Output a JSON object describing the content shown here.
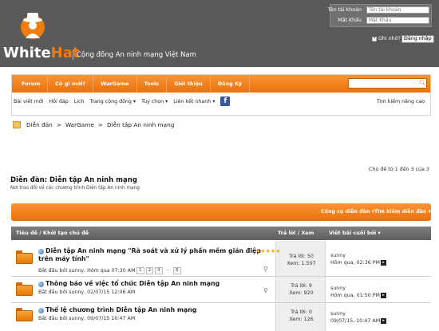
{
  "header": {
    "logo_white": "White",
    "logo_hat": "Hat",
    "tagline": "Cộng đồng An ninh mạng Việt Nam"
  },
  "login": {
    "username_label": "Tên tài khoản",
    "username_placeholder": "Tên tài khoản",
    "password_label": "Mật Khẩu",
    "password_placeholder": "Mật Khẩu",
    "remember_label": "Ghi nhớ?",
    "login_button": "Đăng nhập"
  },
  "nav": {
    "items": [
      "Forum",
      "Có gì mới?",
      "WarGame",
      "Tools",
      "Giới thiệu",
      "Đăng Ký"
    ]
  },
  "subnav": {
    "items": [
      "Bài viết mới",
      "Hỏi đáp",
      "Lịch",
      "Trang cộng đồng ▾",
      "Tùy chọn ▾",
      "Liên kết nhanh ▾"
    ],
    "advanced_search": "Tìm kiếm nâng cao"
  },
  "breadcrumb": {
    "items": [
      "Diễn đàn",
      ">",
      "WarGame",
      ">",
      "Diễn tập An ninh mạng"
    ]
  },
  "forum": {
    "pagecount": "Chủ đề từ 1 đến 3 của 3",
    "title": "Diễn đàn: Diễn tập An ninh mạng",
    "description": "Nơi trao đổi về các chương trình Diễn tập An ninh mạng"
  },
  "actions": {
    "tools": "Công cụ diễn đàn ▾",
    "search": "Tìm kiếm diễn đàn ▾"
  },
  "table": {
    "col_title": "Tiêu đề / Khởi tạo chủ đề",
    "col_stats": "Trả lời / Xem",
    "col_last": "Viết bài cuối bởi ▾"
  },
  "threads": [
    {
      "title_line1": "Diễn tập An ninh mạng \"Rà soát và xử lý phần mềm gián điệp",
      "title_line2": "trên máy tính\"",
      "starter": "Bắt đầu bởi sunny, Hôm qua 07:30 AM",
      "pages": [
        "1",
        "2",
        "3",
        "...",
        "6"
      ],
      "stars": "★★★★★",
      "replies": "Trả lời: 50",
      "views": "Xem: 1.507",
      "last_user": "sunny",
      "last_time": "Hôm qua, 02:36 PM"
    },
    {
      "title_line1": "Thông báo về việc tổ chức Diễn tập An ninh mạng",
      "title_line2": "",
      "starter": "Bắt đầu bởi sunny, 02/07/15 12:06 AM",
      "pages": [],
      "stars": "",
      "replies": "Trả lời: 9",
      "views": "Xem: 920",
      "last_user": "sunny",
      "last_time": "Hôm qua, 01:50 PM"
    },
    {
      "title_line1": "Thể lệ chương trình Diễn tập An ninh mạng",
      "title_line2": "",
      "starter": "Bắt đầu bởi sunny, 09/07/15 10:47 AM",
      "pages": [],
      "stars": "",
      "replies": "Trả lời: 0",
      "views": "Xem: 126",
      "last_user": "sunny",
      "last_time": "09/07/15, 10:47 AM"
    }
  ],
  "colors": {
    "orange": "#ee7009",
    "header_gray": "#595959",
    "table_header": "#6b6b6b"
  }
}
